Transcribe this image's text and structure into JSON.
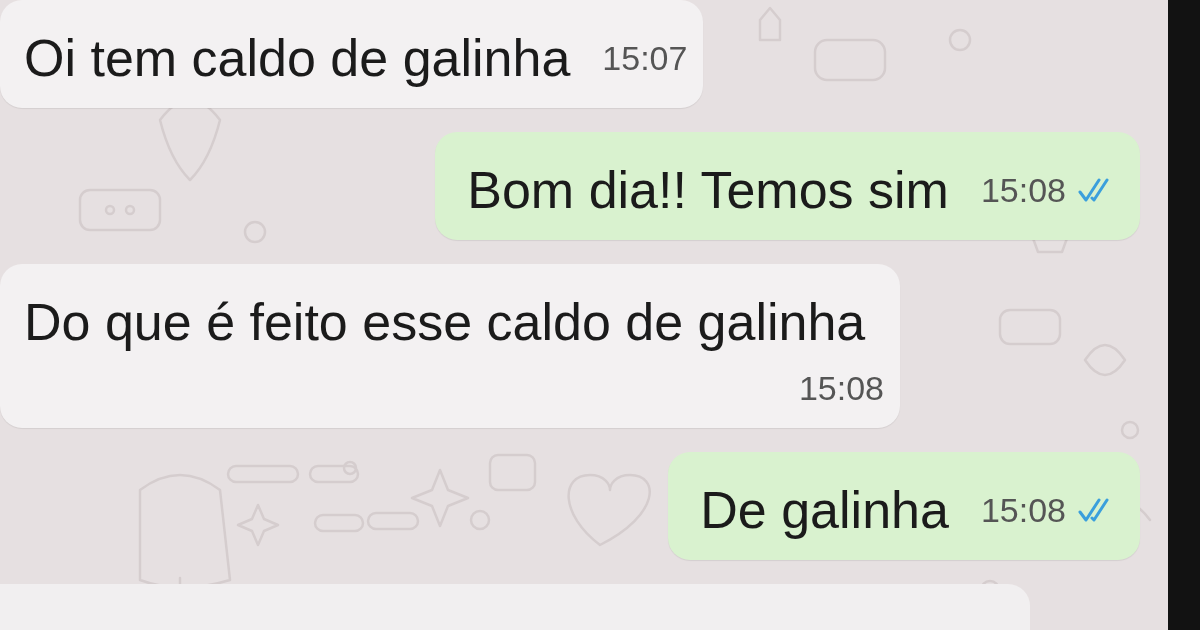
{
  "chat": {
    "messages": [
      {
        "kind": "incoming",
        "text": "Oi tem caldo de galinha",
        "time": "15:07"
      },
      {
        "kind": "outgoing",
        "text": "Bom dia!! Temos sim",
        "time": "15:08",
        "read": true
      },
      {
        "kind": "incoming",
        "text": "Do que é feito esse caldo de galinha",
        "time": "15:08"
      },
      {
        "kind": "outgoing",
        "text": "De galinha",
        "time": "15:08",
        "read": true
      }
    ]
  }
}
